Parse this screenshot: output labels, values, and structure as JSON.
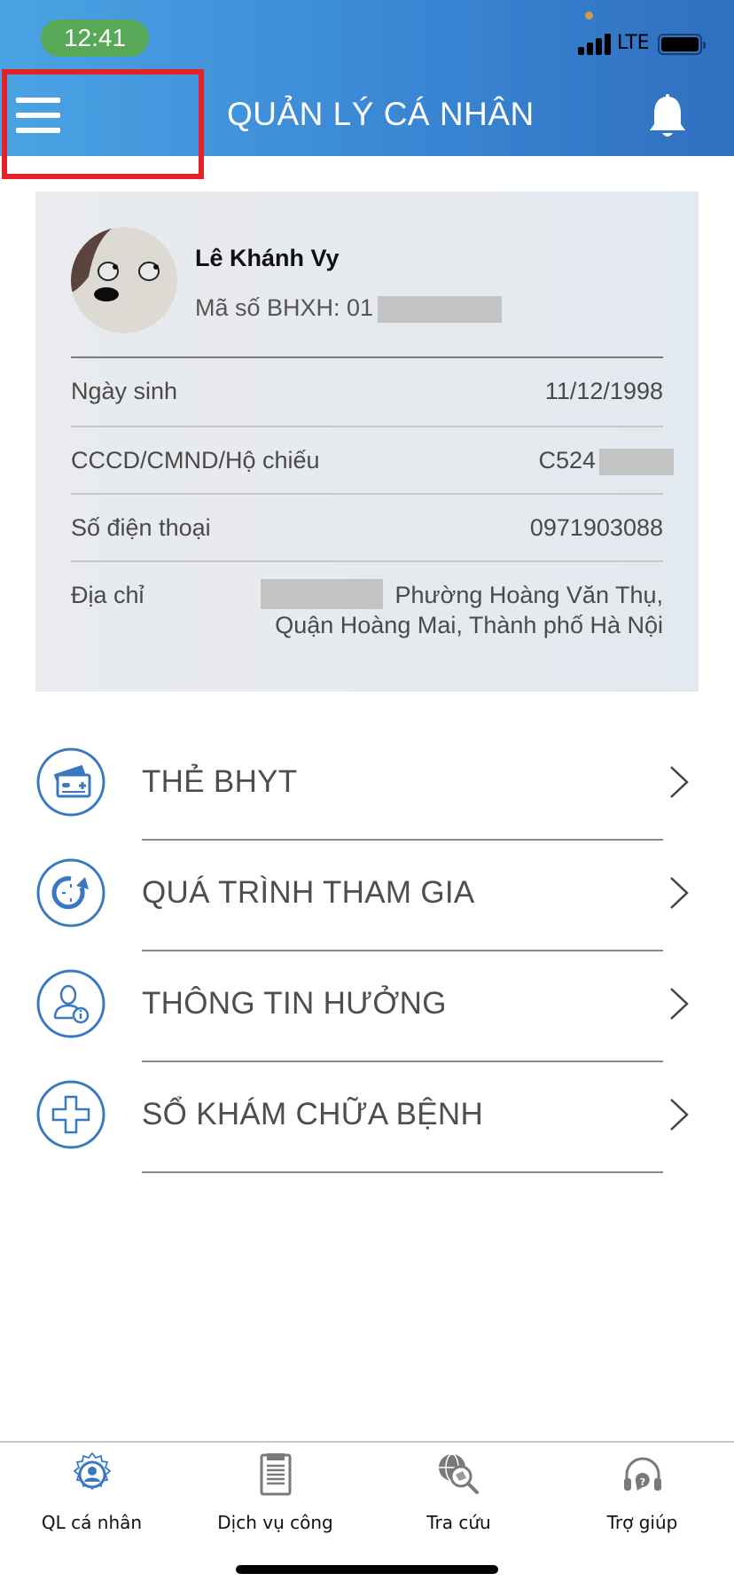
{
  "status_bar": {
    "time": "12:41",
    "network": "LTE"
  },
  "header": {
    "title": "QUẢN LÝ CÁ NHÂN",
    "menu_icon": "hamburger-menu-icon",
    "notification_icon": "bell-icon"
  },
  "profile": {
    "name": "Lê Khánh Vy",
    "bhxh_label": "Mã số BHXH: 01",
    "fields": [
      {
        "label": "Ngày sinh",
        "value": "11/12/1998"
      },
      {
        "label": "CCCD/CMND/Hộ chiếu",
        "value": "C524"
      },
      {
        "label": "Số điện thoại",
        "value": "0971903088"
      },
      {
        "label": "Địa chỉ",
        "value_line1": "Phường Hoàng Văn Thụ,",
        "value_line2": "Quận Hoàng Mai, Thành phố Hà Nội"
      }
    ]
  },
  "menu": [
    {
      "label": "THẺ BHYT",
      "icon": "health-insurance-card-icon"
    },
    {
      "label": "QUÁ TRÌNH THAM GIA",
      "icon": "history-clock-icon"
    },
    {
      "label": "THÔNG TIN HƯỞNG",
      "icon": "user-info-icon"
    },
    {
      "label": "SỔ KHÁM CHỮA BỆNH",
      "icon": "medical-cross-icon"
    }
  ],
  "tabbar": [
    {
      "label": "QL cá nhân",
      "icon": "user-gear-icon",
      "active": true
    },
    {
      "label": "Dịch vụ công",
      "icon": "clipboard-icon",
      "active": false
    },
    {
      "label": "Tra cứu",
      "icon": "globe-search-icon",
      "active": false
    },
    {
      "label": "Trợ giúp",
      "icon": "headset-help-icon",
      "active": false
    }
  ],
  "colors": {
    "header_start": "#4aa3e3",
    "header_end": "#306fc0",
    "accent": "#3a78c2",
    "highlight": "#e52128",
    "time_pill": "#57a857"
  }
}
